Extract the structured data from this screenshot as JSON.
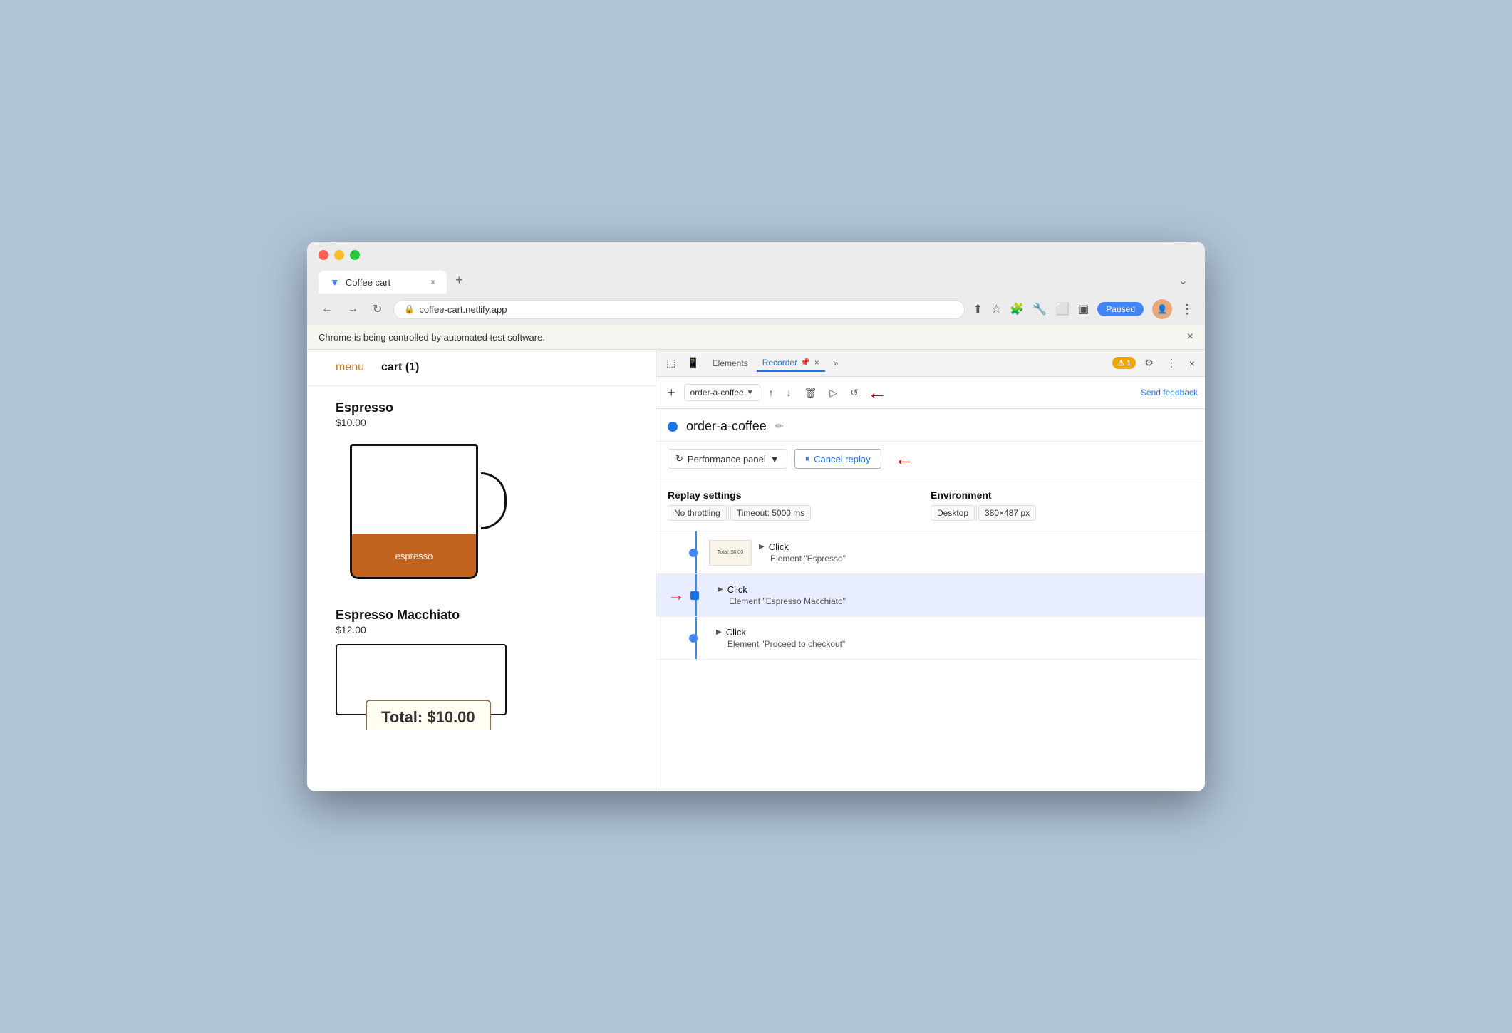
{
  "browser": {
    "tab_title": "Coffee cart",
    "tab_url": "coffee-cart.netlify.app",
    "new_tab_label": "+",
    "chevron_label": "⌄",
    "nav_back": "←",
    "nav_forward": "→",
    "nav_refresh": "↻",
    "paused_label": "Paused",
    "automated_notice": "Chrome is being controlled by automated test software.",
    "notice_close": "×"
  },
  "coffee_page": {
    "nav_menu": "menu",
    "nav_cart": "cart (1)",
    "item1_name": "Espresso",
    "item1_price": "$10.00",
    "item1_liquid_label": "espresso",
    "item2_name": "Espresso Macchiato",
    "item2_price": "$12.00",
    "total_label": "Total: $10.00"
  },
  "devtools": {
    "toolbar": {
      "inspect_icon": "⬚",
      "device_icon": "⬜",
      "elements_tab": "Elements",
      "recorder_tab": "Recorder",
      "recorder_pin": "📌",
      "recorder_close": "×",
      "more_tabs": "»",
      "warn_badge": "1",
      "settings_icon": "⚙",
      "more_icon": "⋮",
      "close_icon": "×"
    },
    "secondary_toolbar": {
      "add_icon": "+",
      "recording_name": "order-a-coffee",
      "upload_icon": "↑",
      "download_icon": "↓",
      "delete_icon": "🗑",
      "play_icon": "▷",
      "replay_icon": "↺",
      "send_feedback": "Send feedback"
    },
    "recording_header": {
      "title": "order-a-coffee",
      "edit_icon": "✏"
    },
    "perf_bar": {
      "perf_panel_label": "Performance panel",
      "perf_chevron": "▼",
      "cancel_replay_label": "Cancel replay",
      "pause_icon": "⏸"
    },
    "settings": {
      "left_title": "Replay settings",
      "throttling": "No throttling",
      "timeout": "Timeout: 5000 ms",
      "right_title": "Environment",
      "desktop": "Desktop",
      "resolution": "380×487 px"
    },
    "steps": [
      {
        "id": "step1",
        "highlighted": false,
        "action": "Click",
        "element": "Element \"Espresso\"",
        "has_thumbnail": true,
        "thumbnail_text": "Total: $0.00",
        "has_red_arrow": false
      },
      {
        "id": "step2",
        "highlighted": true,
        "action": "Click",
        "element": "Element \"Espresso Macchiato\"",
        "has_thumbnail": false,
        "thumbnail_text": "",
        "has_red_arrow": true
      },
      {
        "id": "step3",
        "highlighted": false,
        "action": "Click",
        "element": "Element \"Proceed to checkout\"",
        "has_thumbnail": false,
        "thumbnail_text": "",
        "has_red_arrow": false
      }
    ]
  }
}
